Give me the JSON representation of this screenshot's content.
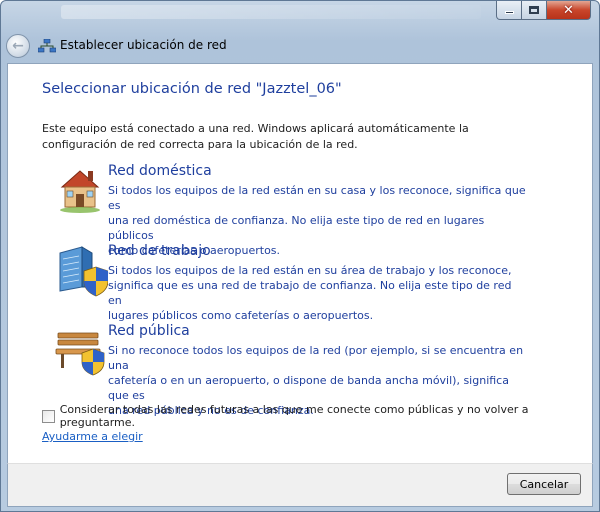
{
  "nav": {
    "title": "Establecer ubicación de red"
  },
  "main": {
    "title": "Seleccionar ubicación de red \"Jazztel_06\"",
    "intro_line1": "Este equipo está conectado a una red. Windows aplicará automáticamente la",
    "intro_line2": "configuración de red correcta para la ubicación de la red."
  },
  "options": [
    {
      "title": "Red doméstica",
      "desc_line1": "Si todos los equipos de la red están en su casa y los reconoce, significa que es",
      "desc_line2": "una red doméstica de confianza. No elija este tipo de red en lugares públicos",
      "desc_line3": "como cafeterías o aeropuertos.",
      "icon": "house-icon"
    },
    {
      "title": "Red de trabajo",
      "desc_line1": "Si todos los equipos de la red están en su área de trabajo y los reconoce,",
      "desc_line2": "significa que es una red de trabajo de confianza. No elija este tipo de red en",
      "desc_line3": "lugares públicos como cafeterías o aeropuertos.",
      "icon": "office-building-shield-icon"
    },
    {
      "title": "Red pública",
      "desc_line1": "Si no reconoce todos los equipos de la red (por ejemplo, si se encuentra en una",
      "desc_line2": "cafetería o en un aeropuerto, o dispone de banda ancha móvil), significa que es",
      "desc_line3": "una red pública y no es de confianza.",
      "icon": "park-bench-shield-icon"
    }
  ],
  "checkbox": {
    "label": "Considerar todas las redes futuras a las que me conecte como públicas y no volver a preguntarme.",
    "checked": false
  },
  "help_link": "Ayudarme a elegir",
  "footer": {
    "cancel_label": "Cancelar"
  },
  "colors": {
    "title_blue": "#1f3f9e",
    "link_blue": "#1a5fc4",
    "close_red": "#c9462b"
  }
}
